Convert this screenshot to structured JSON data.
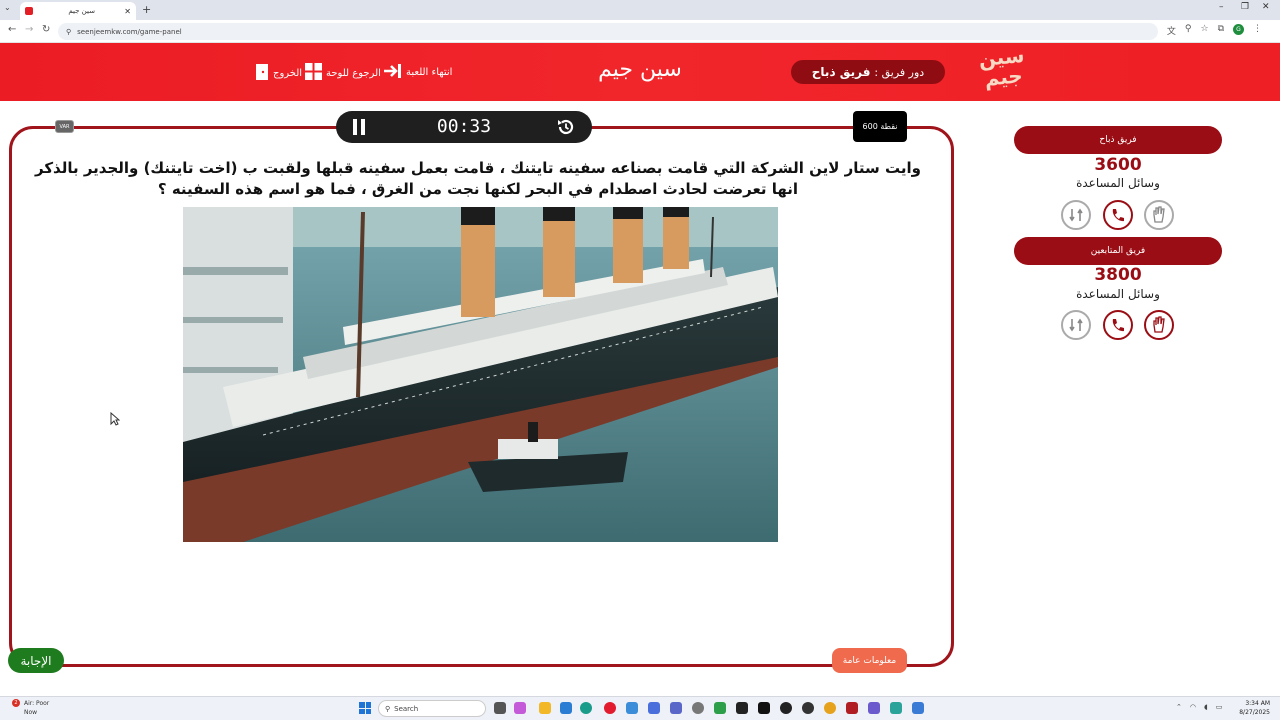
{
  "browser": {
    "tab_title": "سين جيم",
    "url": "seenjeemkw.com/game-panel",
    "new_tab": "+"
  },
  "header": {
    "logo_text": "سين جيم",
    "turn_label": "دور فريق :",
    "turn_team": "فريق ذباح",
    "title": "سين جيم",
    "end_game": "انتهاء اللعبة",
    "back_to_board": "الرجوع للوحة",
    "exit": "الخروج"
  },
  "game": {
    "timer": "00:33",
    "points": "600 نقطة",
    "var_label": "VAR",
    "question": "وايت ستار لاين الشركة التي قامت بصناعه سفينه تايتنك ، قامت بعمل سفينه قبلها ولقبت ب (اخت تايتنك) والجدير بالذكر انها تعرضت لحادث اصطدام في البحر لكنها نجت من الغرق ، فما هو اسم هذه السفينه ؟",
    "answer_button": "الإجابة",
    "category_button": "معلومات عامة"
  },
  "teams": [
    {
      "name": "فريق ذباح",
      "score": "3600",
      "aids_label": "وسائل المساعدة"
    },
    {
      "name": "فريق المتابعين",
      "score": "3800",
      "aids_label": "وسائل المساعدة"
    }
  ],
  "taskbar": {
    "weather_line1": "Air: Poor",
    "weather_line2": "Now",
    "notif_count": "2",
    "search_placeholder": "Search",
    "time": "3:34 AM",
    "date": "8/27/2025"
  },
  "colors": {
    "brand_red": "#ec1c24",
    "dark_red": "#9b0d14",
    "answer_green": "#1e7b1e",
    "category_orange": "#f06a4e"
  },
  "icons": {
    "swap_aid": "swap-icon",
    "call_aid": "phone-icon",
    "hand_aid": "hand-icon"
  }
}
